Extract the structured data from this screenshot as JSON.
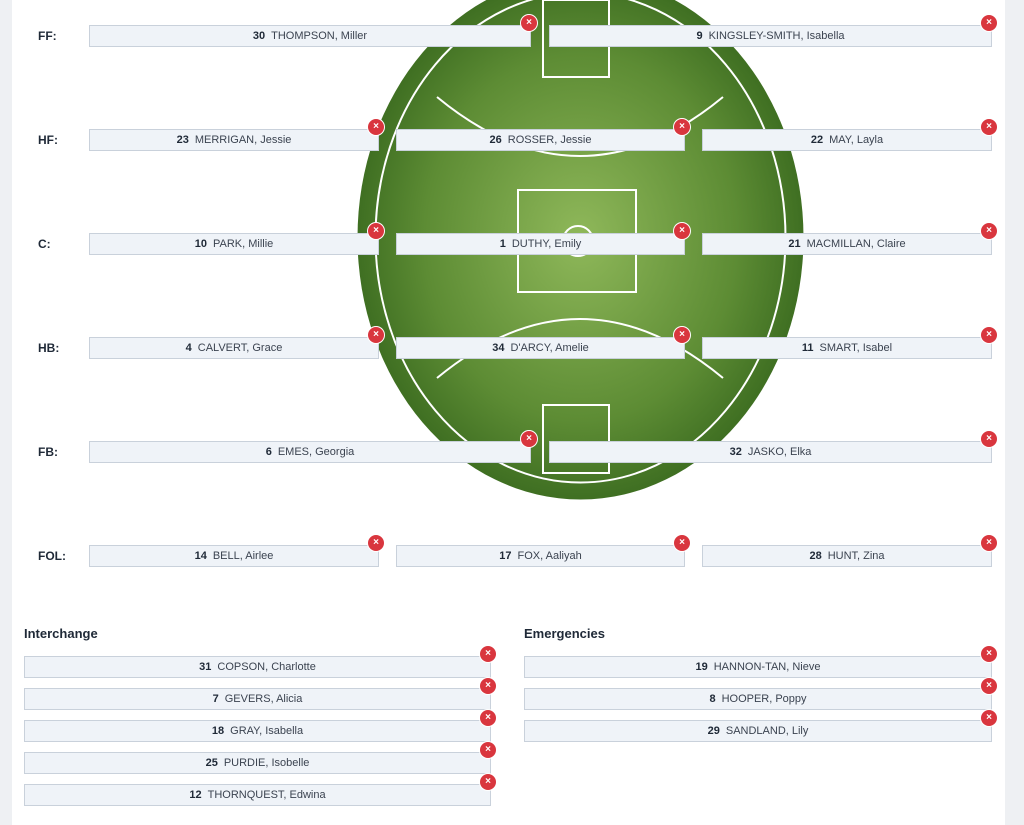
{
  "colors": {
    "field_dark": "#3f6f22",
    "field_light": "#8fb85a",
    "remove": "#d9363e",
    "slot_bg": "#eff3f8"
  },
  "rows": [
    {
      "label": "FF:",
      "players": [
        {
          "num": "30",
          "name": "THOMPSON, Miller"
        },
        {
          "num": "9",
          "name": "KINGSLEY-SMITH, Isabella"
        }
      ]
    },
    {
      "label": "HF:",
      "players": [
        {
          "num": "23",
          "name": "MERRIGAN, Jessie"
        },
        {
          "num": "26",
          "name": "ROSSER, Jessie"
        },
        {
          "num": "22",
          "name": "MAY, Layla"
        }
      ]
    },
    {
      "label": "C:",
      "players": [
        {
          "num": "10",
          "name": "PARK, Millie"
        },
        {
          "num": "1",
          "name": "DUTHY, Emily"
        },
        {
          "num": "21",
          "name": "MACMILLAN, Claire"
        }
      ]
    },
    {
      "label": "HB:",
      "players": [
        {
          "num": "4",
          "name": "CALVERT, Grace"
        },
        {
          "num": "34",
          "name": "D'ARCY, Amelie"
        },
        {
          "num": "11",
          "name": "SMART, Isabel"
        }
      ]
    },
    {
      "label": "FB:",
      "players": [
        {
          "num": "6",
          "name": "EMES, Georgia"
        },
        {
          "num": "32",
          "name": "JASKO, Elka"
        }
      ]
    },
    {
      "label": "FOL:",
      "players": [
        {
          "num": "14",
          "name": "BELL, Airlee"
        },
        {
          "num": "17",
          "name": "FOX, Aaliyah"
        },
        {
          "num": "28",
          "name": "HUNT, Zina"
        }
      ]
    }
  ],
  "interchange": {
    "title": "Interchange",
    "players": [
      {
        "num": "31",
        "name": "COPSON, Charlotte"
      },
      {
        "num": "7",
        "name": "GEVERS, Alicia"
      },
      {
        "num": "18",
        "name": "GRAY, Isabella"
      },
      {
        "num": "25",
        "name": "PURDIE, Isobelle"
      },
      {
        "num": "12",
        "name": "THORNQUEST, Edwina"
      }
    ]
  },
  "emergencies": {
    "title": "Emergencies",
    "players": [
      {
        "num": "19",
        "name": "HANNON-TAN, Nieve"
      },
      {
        "num": "8",
        "name": "HOOPER, Poppy"
      },
      {
        "num": "29",
        "name": "SANDLAND, Lily"
      }
    ]
  },
  "remove_icon": "×"
}
